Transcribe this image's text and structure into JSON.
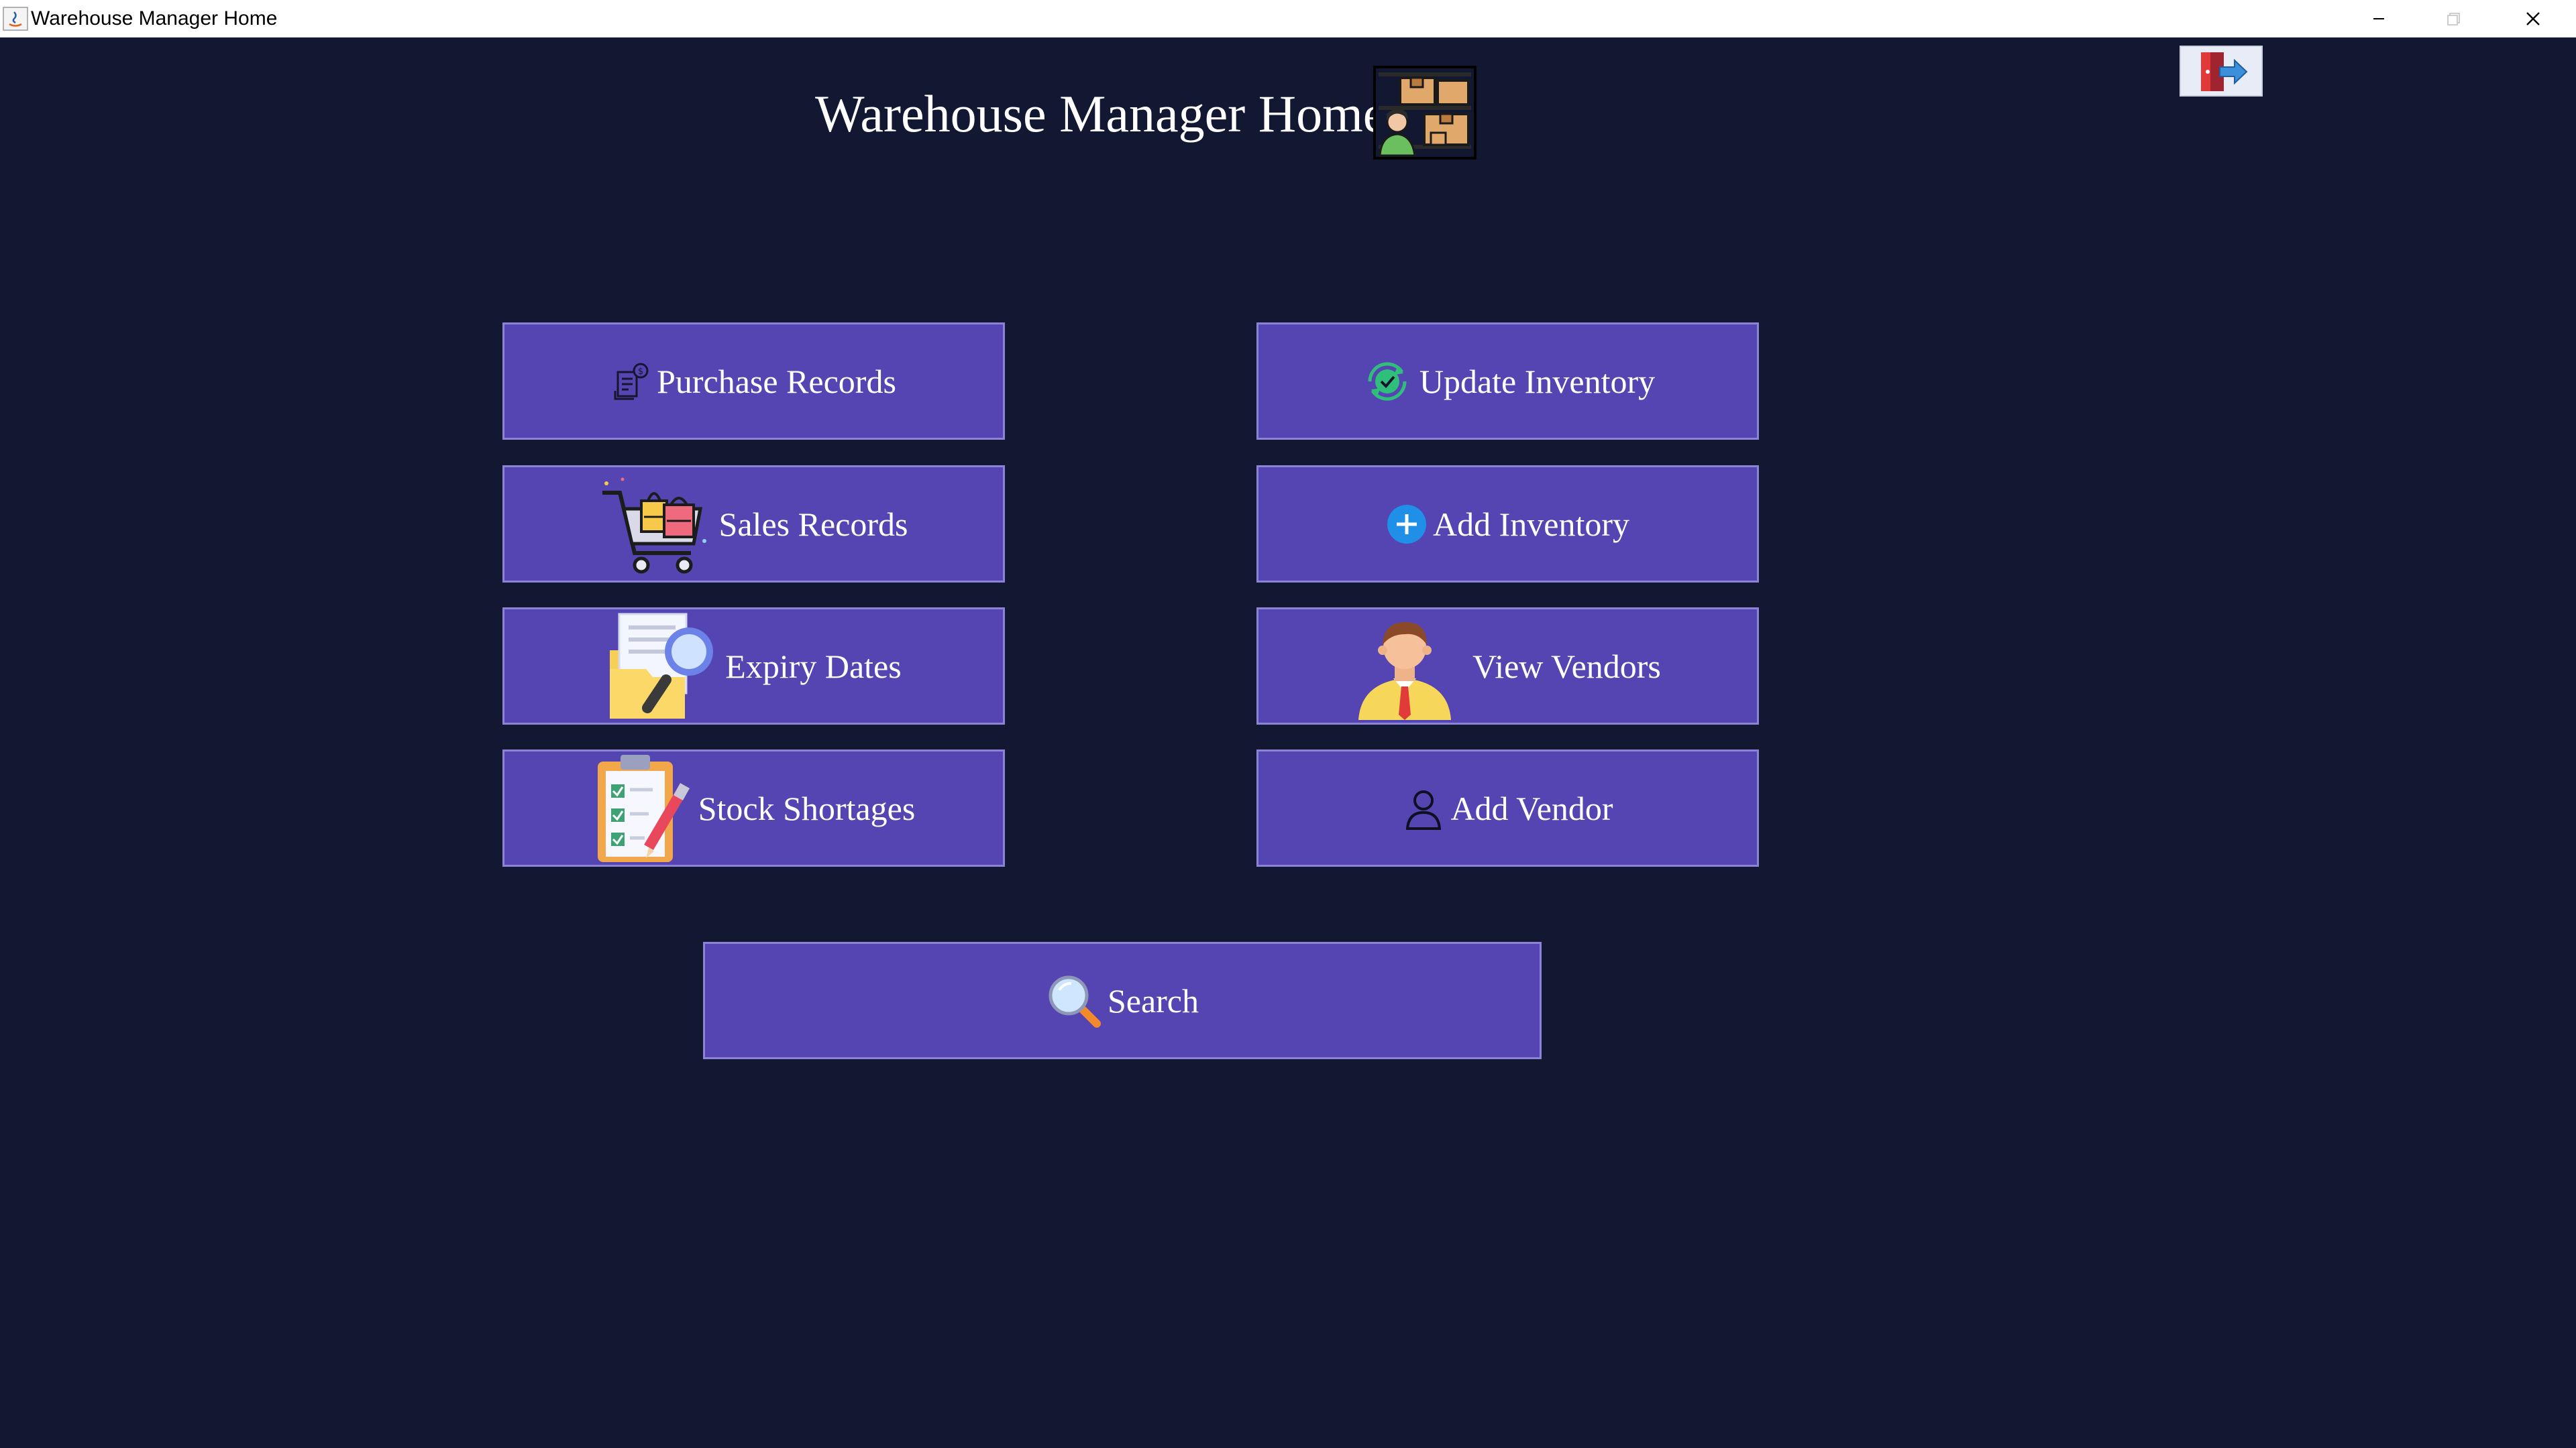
{
  "window": {
    "title": "Warehouse Manager Home"
  },
  "header": {
    "title": "Warehouse Manager Home",
    "icon": "warehouse-manager-icon"
  },
  "exit_button": {
    "icon": "logout-icon"
  },
  "left_column": [
    {
      "label": "Purchase Records",
      "icon": "receipt-icon"
    },
    {
      "label": "Sales Records",
      "icon": "shopping-cart-icon"
    },
    {
      "label": "Expiry Dates",
      "icon": "folder-search-icon"
    },
    {
      "label": "Stock Shortages",
      "icon": "clipboard-checklist-icon"
    }
  ],
  "right_column": [
    {
      "label": "Update Inventory",
      "icon": "refresh-check-icon"
    },
    {
      "label": "Add Inventory",
      "icon": "plus-circle-icon"
    },
    {
      "label": "View Vendors",
      "icon": "vendor-person-icon"
    },
    {
      "label": "Add Vendor",
      "icon": "user-outline-icon"
    }
  ],
  "search_button": {
    "label": "Search",
    "icon": "magnifier-icon"
  },
  "colors": {
    "background": "#131832",
    "button_fill": "#5545b3",
    "button_border": "#8c82d6",
    "text": "#ffffff"
  }
}
